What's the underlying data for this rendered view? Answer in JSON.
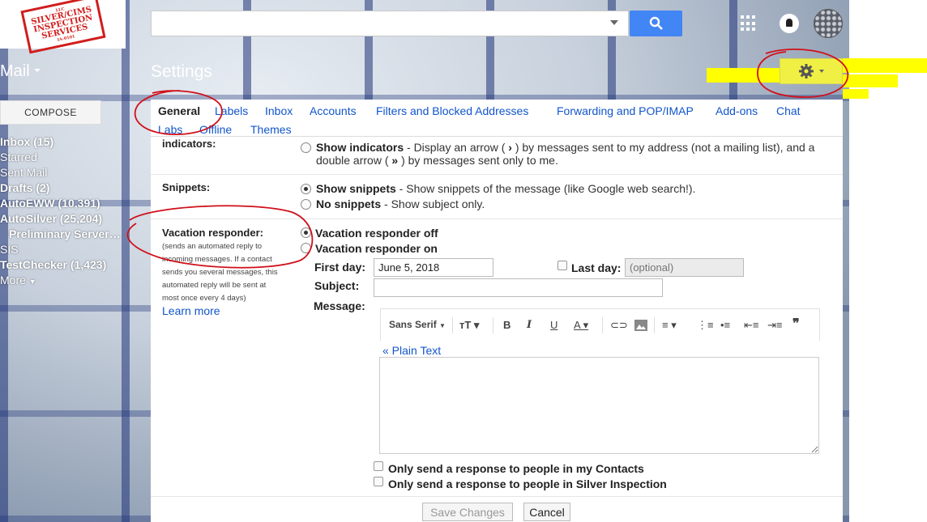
{
  "logo": {
    "line1": "SILVER/CIMS",
    "line2": "INSPECTION",
    "line3": "SERVICES",
    "small_top": "LLC",
    "small_bottom": "IA-0101"
  },
  "header": {
    "search_value": "",
    "app_label": "Mail",
    "page_title": "Settings"
  },
  "icons": {
    "search": "search-icon",
    "apps": "apps-grid-icon",
    "notifications": "bell-icon",
    "avatar": "avatar",
    "settings": "gear-icon"
  },
  "colors": {
    "accent_blue": "#4285f4",
    "link": "#1155cc",
    "highlight": "#ffff00",
    "annotation_red": "#d0101a"
  },
  "sidebar": {
    "compose_label": "COMPOSE",
    "items": [
      {
        "label": "Inbox (15)",
        "bold": true
      },
      {
        "label": "Starred",
        "bold": false
      },
      {
        "label": "Sent Mail",
        "bold": false
      },
      {
        "label": "Drafts (2)",
        "bold": true
      },
      {
        "label": "AutoEWW (10,391)",
        "bold": true
      },
      {
        "label": "AutoSilver (25,204)",
        "bold": true
      },
      {
        "label": "Preliminary Server…",
        "bold": true
      },
      {
        "label": "SIS",
        "bold": false
      },
      {
        "label": "TestChecker (1,423)",
        "bold": true
      },
      {
        "label": "More",
        "bold": false
      }
    ]
  },
  "tabs": [
    "General",
    "Labels",
    "Inbox",
    "Accounts",
    "Filters and Blocked Addresses",
    "Forwarding and POP/IMAP",
    "Add-ons",
    "Chat",
    "Labs",
    "Offline",
    "Themes"
  ],
  "indicators": {
    "label": "indicators:",
    "option_title": "Show indicators",
    "option_text_1": " - Display an arrow ( ",
    "arrow_single": "›",
    "option_text_2": " ) by messages sent to my address (not a mailing list), and a",
    "option_text_3": "double arrow ( ",
    "arrow_double": "»",
    "option_text_4": " ) by messages sent only to me."
  },
  "snippets": {
    "label": "Snippets:",
    "show_title": "Show snippets",
    "show_text": " - Show snippets of the message (like Google web search!).",
    "no_title": "No snippets",
    "no_text": " - Show subject only."
  },
  "vacation": {
    "label": "Vacation responder:",
    "desc_lines": [
      "(sends an automated reply to",
      "incoming messages. If a contact",
      "sends you several messages, this",
      "automated reply will be sent at",
      "most once every 4 days)"
    ],
    "learn_more": "Learn more",
    "off_label": "Vacation responder off",
    "on_label": "Vacation responder on",
    "first_day_label": "First day:",
    "first_day_value": "June 5, 2018",
    "last_day_label": "Last day:",
    "last_day_placeholder": "(optional)",
    "subject_label": "Subject:",
    "subject_value": "",
    "message_label": "Message:"
  },
  "editor": {
    "font_family": "Sans Serif",
    "plain_text_link": "« Plain Text",
    "message_value": ""
  },
  "options": {
    "contacts_only": "Only send a response to people in my Contacts",
    "domain_only": "Only send a response to people in Silver Inspection"
  },
  "buttons": {
    "save": "Save Changes",
    "cancel": "Cancel"
  }
}
